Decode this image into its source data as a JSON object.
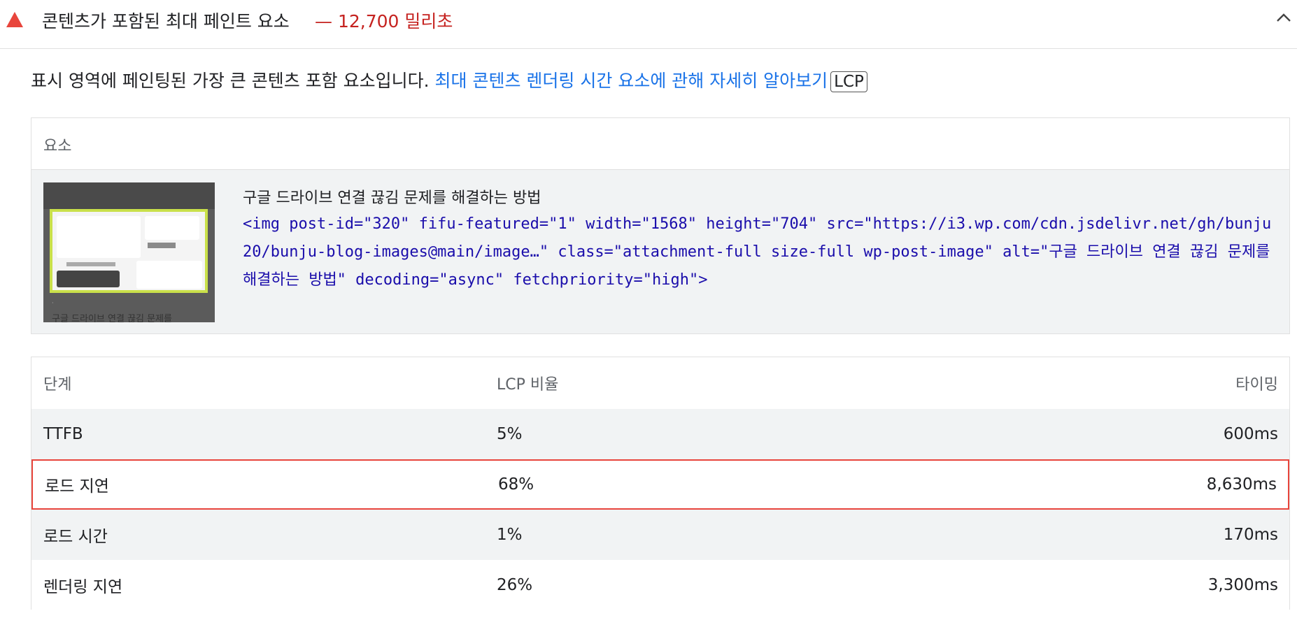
{
  "audit": {
    "title": "콘텐츠가 포함된 최대 페인트 요소",
    "value": "— 12,700 밀리초",
    "status_color": "#c5221f",
    "status_icon": "warning-triangle-icon",
    "collapse_icon": "chevron-up-icon"
  },
  "description": {
    "text": "표시 영역에 페인팅된 가장 큰 콘텐츠 포함 요소입니다.",
    "link_text": "최대 콘텐츠 렌더링 시간 요소에 관해 자세히 알아보기",
    "badge": "LCP"
  },
  "element_table": {
    "header": "요소",
    "row": {
      "thumbnail_caption": "구글 드라이브 연결 끊김 문제를",
      "node_label": "구글 드라이브 연결 끊김 문제를 해결하는 방법",
      "snippet": "<img post-id=\"320\" fifu-featured=\"1\" width=\"1568\" height=\"704\" src=\"https://i3.wp.com/cdn.jsdelivr.net/gh/bunju20/bunju-blog-images@main/image…\" class=\"attachment-full size-full wp-post-image\" alt=\"구글 드라이브 연결 끊김 문제를 해결하는 방법\" decoding=\"async\" fetchpriority=\"high\">"
    }
  },
  "phase_table": {
    "headers": {
      "phase": "단계",
      "pct": "LCP 비율",
      "timing": "타이밍"
    },
    "rows": [
      {
        "phase": "TTFB",
        "pct": "5%",
        "timing": "600ms"
      },
      {
        "phase": "로드 지연",
        "pct": "68%",
        "timing": "8,630ms"
      },
      {
        "phase": "로드 시간",
        "pct": "1%",
        "timing": "170ms"
      },
      {
        "phase": "렌더링 지연",
        "pct": "26%",
        "timing": "3,300ms"
      }
    ],
    "highlight_color": "#e8453c"
  }
}
